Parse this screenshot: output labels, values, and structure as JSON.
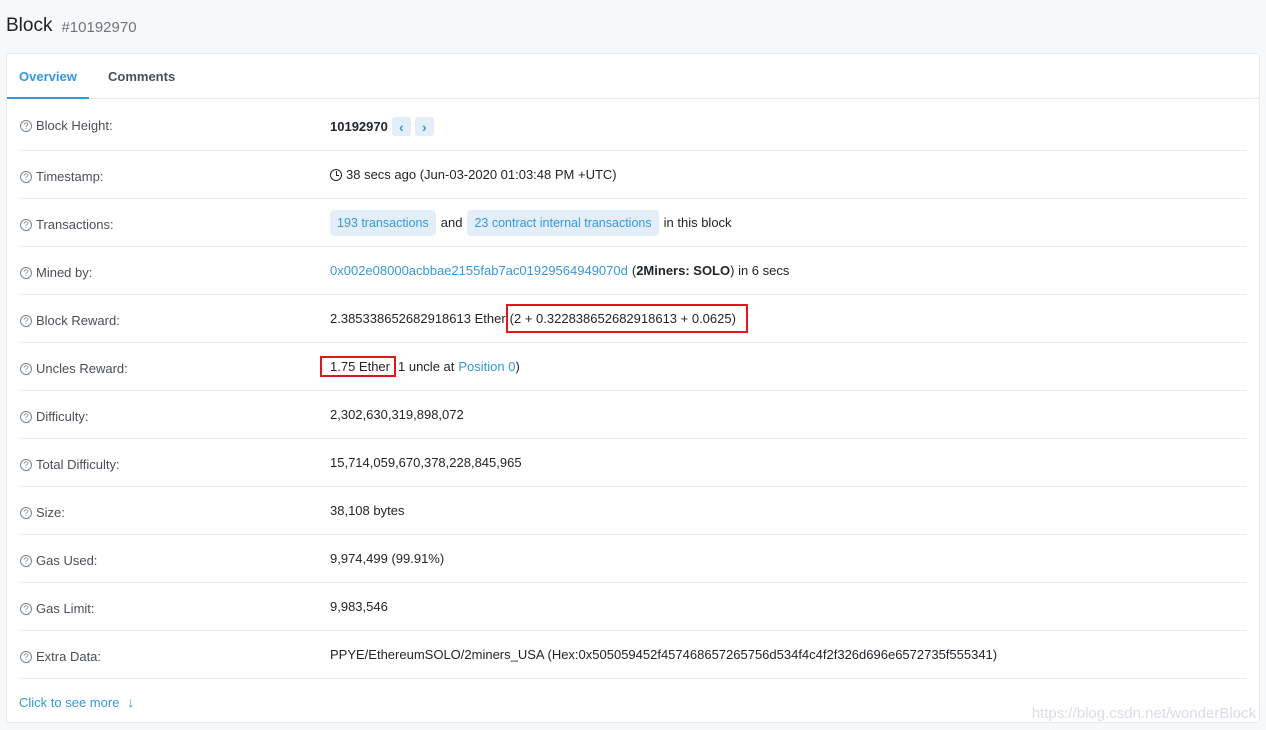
{
  "header": {
    "title": "Block",
    "block_number": "#10192970"
  },
  "tabs": [
    "Overview",
    "Comments"
  ],
  "rows": {
    "block_height": {
      "label": "Block Height:",
      "value": "10192970",
      "prev": "‹",
      "next": "›"
    },
    "timestamp": {
      "label": "Timestamp:",
      "value": "38 secs ago (Jun-03-2020 01:03:48 PM +UTC)"
    },
    "transactions": {
      "label": "Transactions:",
      "tx_link": "193 transactions",
      "and": "and",
      "internal_link": "23 contract internal transactions",
      "suffix": "in this block"
    },
    "mined_by": {
      "label": "Mined by:",
      "address": "0x002e08000acbbae2155fab7ac01929564949070d",
      "open": "(",
      "miner": "2Miners: SOLO",
      "suffix": ") in 6 secs"
    },
    "block_reward": {
      "label": "Block Reward:",
      "value": "2.385338652682918613 Ether",
      "breakdown": "(2 + 0.322838652682918613 + 0.0625)"
    },
    "uncles_reward": {
      "label": "Uncles Reward:",
      "value": "1.75 Ether",
      "middle": "1 uncle at",
      "position_link": "Position 0",
      "close": ")"
    },
    "difficulty": {
      "label": "Difficulty:",
      "value": "2,302,630,319,898,072"
    },
    "total_difficulty": {
      "label": "Total Difficulty:",
      "value": "15,714,059,670,378,228,845,965"
    },
    "size": {
      "label": "Size:",
      "value": "38,108 bytes"
    },
    "gas_used": {
      "label": "Gas Used:",
      "value": "9,974,499 (99.91%)"
    },
    "gas_limit": {
      "label": "Gas Limit:",
      "value": "9,983,546"
    },
    "extra_data": {
      "label": "Extra Data:",
      "value": "PPYE/EthereumSOLO/2miners_USA (Hex:0x505059452f457468657265756d534f4c4f2f326d696e6572735f555341)"
    }
  },
  "see_more": "Click to see more",
  "watermark": "https://blog.csdn.net/wonderBlock",
  "colors": {
    "accent": "#3498db",
    "highlight_border": "#e0161c"
  },
  "icons": {
    "help": "question-circle-icon",
    "clock": "clock-icon",
    "arrow": "arrow-down-icon"
  }
}
